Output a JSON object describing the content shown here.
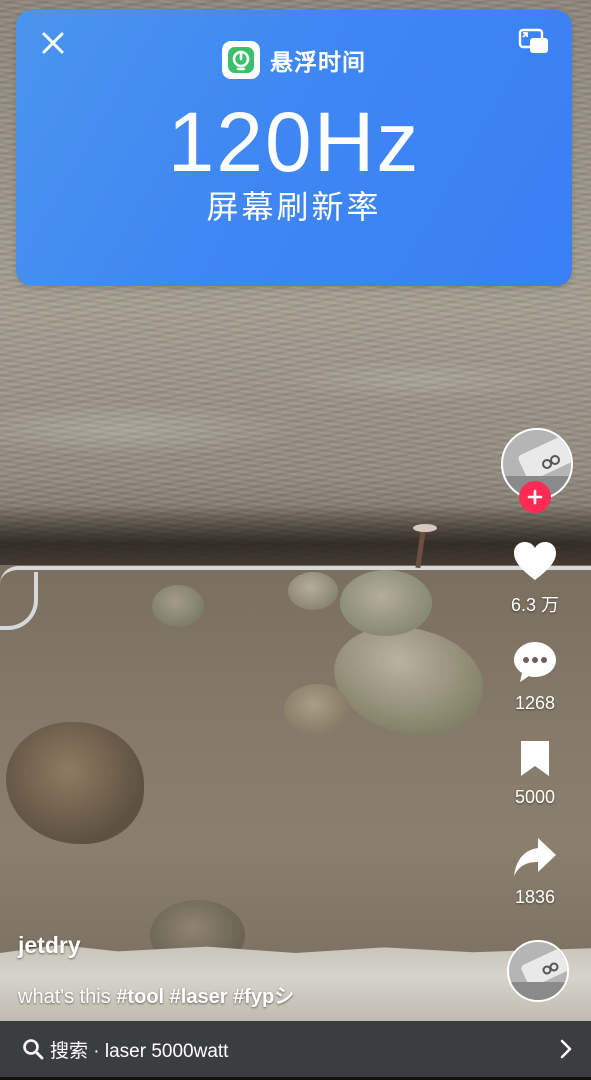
{
  "floating_window": {
    "app_name": "悬浮时间",
    "refresh_rate": "120Hz",
    "refresh_label": "屏幕刷新率"
  },
  "actions": {
    "likes": "6.3 万",
    "comments": "1268",
    "saves": "5000",
    "shares": "1836"
  },
  "post": {
    "username": "jetdry",
    "caption_text": "what's this",
    "hashtags": [
      "#tool",
      "#laser",
      "#fypシ"
    ]
  },
  "search_bar": {
    "text": "搜索 · laser 5000watt"
  },
  "colors": {
    "card_blue": "#3f87f3",
    "follow_red": "#fe2c55",
    "search_bg": "#3c3d40"
  },
  "icons": [
    "close-icon",
    "app-icon",
    "window-restore-icon",
    "heart-icon",
    "comment-icon",
    "bookmark-icon",
    "share-icon",
    "search-icon",
    "chevron-right-icon",
    "plus-icon"
  ]
}
